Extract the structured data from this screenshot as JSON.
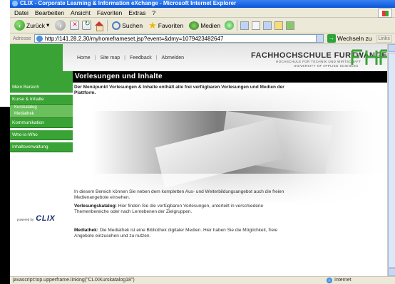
{
  "window": {
    "title": "CLIX - Corporate Learning & Information eXchange - Microsoft Internet Explorer"
  },
  "menu": [
    "Datei",
    "Bearbeiten",
    "Ansicht",
    "Favoriten",
    "Extras",
    "?"
  ],
  "toolbar": {
    "back_label": "Zurück",
    "search_label": "Suchen",
    "favorites_label": "Favoriten",
    "media_label": "Medien"
  },
  "address": {
    "label": "Adresse",
    "url": "http://141.28.2.30/myhomeframeset.jsp?event=&dmy=1079423482647",
    "go_label": "Wechseln zu",
    "links_label": "Links"
  },
  "header": {
    "nav": [
      "Home",
      "Site map",
      "Feedback",
      "Abmelden"
    ],
    "institution_name": "FACHHOCHSCHULE FURTWANGEN",
    "institution_sub1": "HOCHSCHULE FÜR TECHNIK UND WIRTSCHAFT",
    "institution_sub2": "UNIVERSITY OF APPLIED SCIENCES"
  },
  "section_title": "Vorlesungen und Inhalte",
  "sidebar": {
    "items": [
      "Mein Bereich",
      "Kurse & Inhalte"
    ],
    "subitems": [
      "Kurskatalog",
      "Mediathek"
    ],
    "items2": [
      "Kommunikation",
      "Who-is-Who",
      "Inhaltsverwaltung"
    ],
    "powered_by": "powered by",
    "clix_logo": "CLIX"
  },
  "content": {
    "intro": "Der Menüpunkt Vorlesungen & Inhalte enthält alle frei verfügbaren Vorlesungen und Medien der Plattform.",
    "p1": "In diesem Bereich können Sie neben dem kompletten Aus- und Weiterbildungsangebot auch die freien Medienangebote einsehen.",
    "p2_label": "Vorlesungskatalog:",
    "p2_text": " Hier finden Sie die verfügbaren Vorlesungen, unterteilt in verschiedene Themenbereiche oder nach Lernebenen der Zielgruppen.",
    "p3_label": "Mediathek:",
    "p3_text": " Die Mediathek ist eine Bibliothek digitaler Medien. Hier haben Sie die Möglichkeit, freie Angebote einzusehen und zu nutzen."
  },
  "status": {
    "text": "javascript:top.upperframe.linking(\"CLIXKurskatalog18\")",
    "zone": "Internet"
  },
  "colors": {
    "brand_green": "#3aa335",
    "title_bar_bg": "#000000"
  }
}
